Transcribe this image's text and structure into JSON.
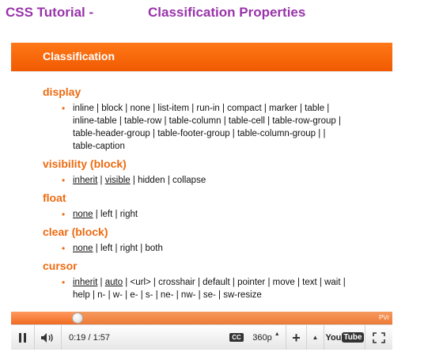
{
  "page": {
    "title_prefix": "CSS Tutorial -",
    "title_main": "Classification Properties"
  },
  "slide": {
    "header": "Classification",
    "sections": [
      {
        "heading": "display",
        "values_text": "inline | block | none | list-item | run-in | compact | marker | table | inline-table | table-row | table-column | table-cell | table-row-group | table-header-group | table-footer-group | table-column-group | | table-caption",
        "underlined": []
      },
      {
        "heading": "visibility (block)",
        "values": [
          "inherit",
          "visible",
          "hidden",
          "collapse"
        ],
        "underlined": [
          "inherit",
          "visible"
        ]
      },
      {
        "heading": "float",
        "values": [
          "none",
          "left",
          "right"
        ],
        "underlined": [
          "none"
        ]
      },
      {
        "heading": "clear (block)",
        "values": [
          "none",
          "left",
          "right",
          "both"
        ],
        "underlined": [
          "none"
        ]
      },
      {
        "heading": "cursor",
        "values": [
          "inherit",
          "auto",
          "<url>",
          "crosshair",
          "default",
          "pointer",
          "move",
          "text",
          "wait",
          "help",
          "n-",
          "w-",
          "e-",
          "s-",
          "ne-",
          "nw-",
          "se-",
          "sw-resize"
        ],
        "underlined": [
          "inherit",
          "auto"
        ]
      }
    ]
  },
  "player": {
    "progress": 0.175,
    "buffered": 0.55,
    "badge": "PVr",
    "time": "0:19 / 1:57",
    "cc_label": "CC",
    "quality": "360p",
    "logo_you": "You",
    "logo_tube": "Tube",
    "icons": {
      "pause": "pause-icon",
      "volume": "volume-icon",
      "cc": "captions-icon",
      "zoom": "plus-icon",
      "popout": "arrow-up-icon",
      "fullscreen": "fullscreen-icon"
    },
    "colors": {
      "accent": "#ff6a0a",
      "title": "#9933aa",
      "heading": "#ee6a10"
    }
  }
}
